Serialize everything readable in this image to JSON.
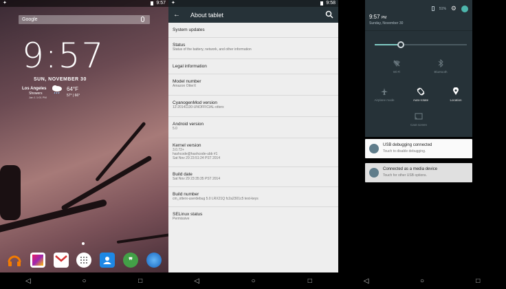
{
  "home": {
    "status_time": "9:57",
    "search_label": "Google",
    "clock": "9:57",
    "date": "SUN, NOVEMBER 30",
    "weather": {
      "city": "Los Angeles",
      "condition": "Showers",
      "updated": "Jan 1 1:01 PM",
      "temp": "64°F",
      "hilo": "57° | 66°"
    },
    "dock_apps": [
      {
        "icon": "headphones-icon",
        "color": "#f57c00"
      },
      {
        "icon": "gallery-icon",
        "color": "#8e44ad"
      },
      {
        "icon": "gmail-icon",
        "color": "#ffffff"
      },
      {
        "icon": "app-drawer-icon",
        "color": "#ffffff"
      },
      {
        "icon": "contacts-icon",
        "color": "#1e88e5"
      },
      {
        "icon": "hangouts-icon",
        "color": "#43a047"
      },
      {
        "icon": "browser-icon",
        "color": "#1e88e5"
      }
    ]
  },
  "about": {
    "status_time": "9:58",
    "title": "About tablet",
    "items": [
      {
        "title": "System updates",
        "lines": []
      },
      {
        "title": "Status",
        "lines": [
          "Status of the battery, network, and other information"
        ]
      },
      {
        "title": "Legal information",
        "lines": []
      },
      {
        "title": "Model number",
        "lines": [
          "Amazon OtterX"
        ]
      },
      {
        "title": "CyanogenMod version",
        "lines": [
          "12-20141130-UNOFFICIAL-otterx"
        ]
      },
      {
        "title": "Android version",
        "lines": [
          "5.0"
        ]
      },
      {
        "title": "Kernel version",
        "lines": [
          "3.0.72+",
          "hashcode@hashcode-ubb #1",
          "Sat Nov 29 23:51:24 PST 2014"
        ]
      },
      {
        "title": "Build date",
        "lines": [
          "Sat Nov 29 23:35:35 PST 2014"
        ]
      },
      {
        "title": "Build number",
        "lines": [
          "cm_otterx-userdebug 5.0 LRX21Q fc2a2301c5 test-keys"
        ]
      },
      {
        "title": "SELinux status",
        "lines": [
          "Permissive"
        ]
      }
    ]
  },
  "shade": {
    "battery": "51%",
    "time": "9:57",
    "ampm": "PM",
    "date": "Sunday, November 30",
    "brightness": 0.28,
    "tiles": [
      {
        "label": "Wi-Fi",
        "icon": "wifi-off-icon"
      },
      {
        "label": "Bluetooth",
        "icon": "bluetooth-icon"
      },
      {
        "label": "Airplane mode",
        "icon": "airplane-icon"
      },
      {
        "label": "Auto-rotate",
        "icon": "rotate-icon"
      },
      {
        "label": "Location",
        "icon": "location-icon"
      },
      {
        "label": "Cast screen",
        "icon": "cast-icon"
      }
    ],
    "notifications": [
      {
        "title": "USB debugging connected",
        "sub": "Touch to disable debugging."
      },
      {
        "title": "Connected as a media device",
        "sub": "Touch for other USB options."
      }
    ]
  },
  "nav": {
    "back": "◁",
    "home": "○",
    "recents": "□"
  }
}
